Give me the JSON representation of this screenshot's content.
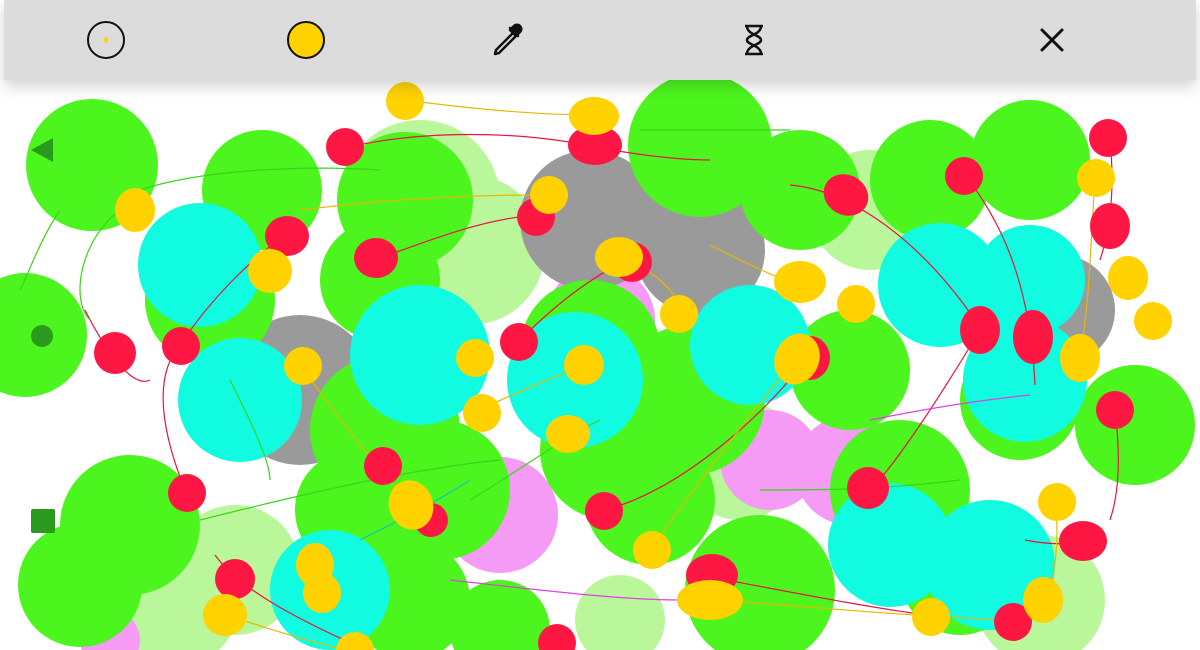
{
  "toolbar": {
    "tools": [
      {
        "id": "point-tool",
        "icon": "dot-circle-icon"
      },
      {
        "id": "color-tool",
        "icon": "filled-circle-icon",
        "color": "#ffd200"
      },
      {
        "id": "picker-tool",
        "icon": "eyedropper-icon"
      },
      {
        "id": "timer-tool",
        "icon": "hourglass-icon"
      },
      {
        "id": "close-tool",
        "icon": "close-icon"
      }
    ]
  },
  "side_controls": [
    {
      "id": "back",
      "icon": "triangle-left-icon",
      "color": "#2a9a1e"
    },
    {
      "id": "record",
      "icon": "dot-icon",
      "color": "#2a9a1e"
    },
    {
      "id": "stop",
      "icon": "square-icon",
      "color": "#2a9a1e"
    }
  ],
  "palette": {
    "green": "#4cf51e",
    "pale_green": "#b9f79a",
    "cyan": "#10fbe0",
    "gray": "#9a9a9a",
    "pink": "#f59af5",
    "red": "#ff1744",
    "yellow": "#ffd200"
  }
}
